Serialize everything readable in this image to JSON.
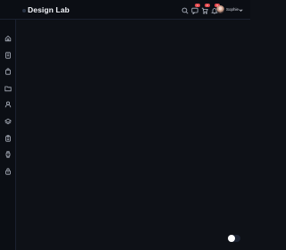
{
  "header": {
    "brand_name": "Design Lab",
    "icons": [
      {
        "name": "search-icon",
        "badge": ""
      },
      {
        "name": "chat-icon",
        "badge": "1"
      },
      {
        "name": "cart-icon",
        "badge": "2"
      },
      {
        "name": "bell-icon",
        "badge": "3"
      }
    ],
    "user": {
      "name": "Sophie"
    }
  },
  "sidebar": {
    "items": [
      {
        "name": "sidebar-item-home"
      },
      {
        "name": "sidebar-item-documents"
      },
      {
        "name": "sidebar-item-cart"
      },
      {
        "name": "sidebar-item-folder"
      },
      {
        "name": "sidebar-item-users"
      },
      {
        "name": "sidebar-item-layers"
      },
      {
        "name": "sidebar-item-calendar"
      },
      {
        "name": "sidebar-item-tasks"
      },
      {
        "name": "sidebar-item-settings"
      }
    ]
  },
  "colors": {
    "background": "#0e1117",
    "chrome": "#0b0e14",
    "badge": "#e5484d",
    "icon": "#aeb4c0"
  }
}
